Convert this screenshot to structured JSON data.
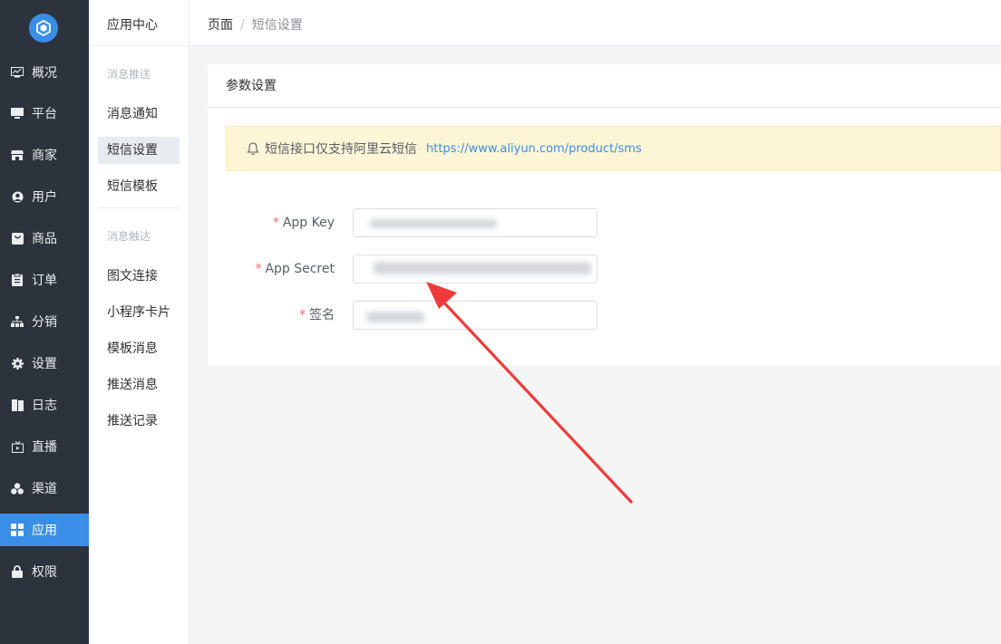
{
  "nav": {
    "items": [
      {
        "label": "概况",
        "icon": "monitor-chart-icon"
      },
      {
        "label": "平台",
        "icon": "desktop-icon"
      },
      {
        "label": "商家",
        "icon": "shop-icon"
      },
      {
        "label": "用户",
        "icon": "user-icon"
      },
      {
        "label": "商品",
        "icon": "shopping-bag-icon"
      },
      {
        "label": "订单",
        "icon": "clipboard-icon"
      },
      {
        "label": "分销",
        "icon": "hierarchy-icon"
      },
      {
        "label": "设置",
        "icon": "gear-icon"
      },
      {
        "label": "日志",
        "icon": "book-icon"
      },
      {
        "label": "直播",
        "icon": "tv-icon"
      },
      {
        "label": "渠道",
        "icon": "cluster-icon"
      },
      {
        "label": "应用",
        "icon": "grid-icon",
        "active": true
      },
      {
        "label": "权限",
        "icon": "lock-icon"
      }
    ],
    "accent_color": "#3a8ee6"
  },
  "submenu": {
    "title": "应用中心",
    "groups": [
      {
        "label": "消息推送",
        "items": [
          "消息通知",
          "短信设置",
          "短信模板"
        ]
      },
      {
        "label": "消息触达",
        "items": [
          "图文连接",
          "小程序卡片",
          "模板消息",
          "推送消息",
          "推送记录"
        ]
      }
    ],
    "active_item": "短信设置"
  },
  "breadcrumb": {
    "home": "页面",
    "separator": "/",
    "current": "短信设置"
  },
  "card": {
    "title": "参数设置",
    "alert": {
      "text": "短信接口仅支持阿里云短信",
      "link": "https://www.aliyun.com/product/sms",
      "icon": "bell-icon"
    },
    "fields": [
      {
        "label": "App Key",
        "required_mark": "*",
        "value": ""
      },
      {
        "label": "App Secret",
        "required_mark": "*",
        "value": ""
      },
      {
        "label": "签名",
        "required_mark": "*",
        "value": ""
      }
    ]
  }
}
